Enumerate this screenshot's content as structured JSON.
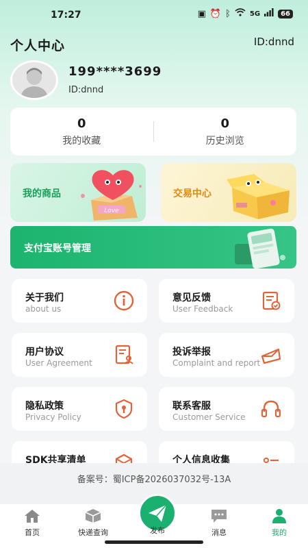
{
  "status_bar": {
    "time": "17:27",
    "network": "5G",
    "battery": "66"
  },
  "header": {
    "title": "个人中心",
    "id": "ID:dnnd"
  },
  "profile": {
    "phone": "199****3699",
    "id": "ID:dnnd"
  },
  "stats": [
    {
      "value": "0",
      "label": "我的收藏"
    },
    {
      "value": "0",
      "label": "历史浏览"
    }
  ],
  "promos": {
    "goods": "我的商品",
    "love_tag": "Love",
    "trade": "交易中心"
  },
  "alipay": {
    "label": "支付宝账号管理"
  },
  "menu": [
    {
      "title": "关于我们",
      "subtitle": "about us",
      "icon": "info-icon"
    },
    {
      "title": "意见反馈",
      "subtitle": "User Feedback",
      "icon": "feedback-icon"
    },
    {
      "title": "用户协议",
      "subtitle": "User Agreement",
      "icon": "agreement-icon"
    },
    {
      "title": "投诉举报",
      "subtitle": "Complaint and report",
      "icon": "complaint-icon"
    },
    {
      "title": "隐私政策",
      "subtitle": "Privacy Policy",
      "icon": "shield-lock-icon"
    },
    {
      "title": "联系客服",
      "subtitle": "Customer Service",
      "icon": "headset-icon"
    },
    {
      "title": "SDK共享清单",
      "subtitle": "",
      "icon": "cube-icon"
    },
    {
      "title": "个人信息收集",
      "subtitle": "",
      "icon": "list-icon"
    }
  ],
  "icp": "备案号：蜀ICP备2026037032号-13A",
  "tabbar": {
    "home": "首页",
    "express": "快递查询",
    "publish": "发布",
    "messages": "消息",
    "mine": "我的"
  },
  "colors": {
    "brand_green": "#19b070",
    "icon_orange": "#e0643a",
    "trade_orange": "#e08a12"
  }
}
